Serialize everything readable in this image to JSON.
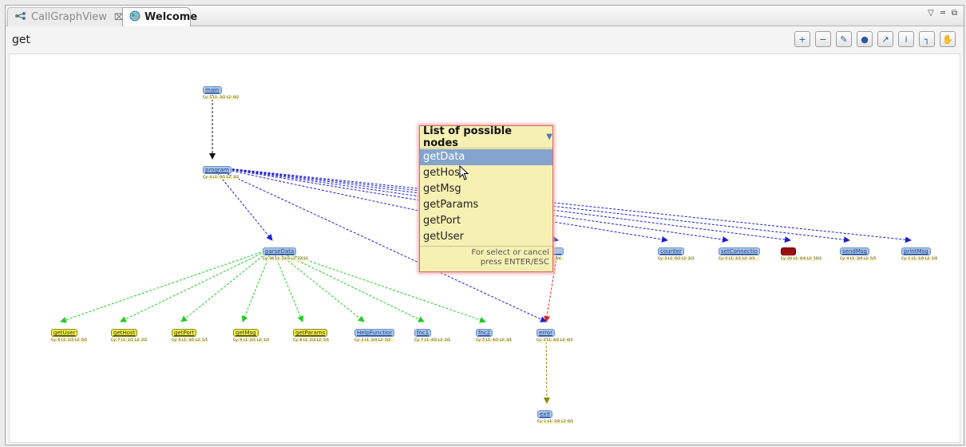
{
  "tabs": [
    {
      "label": "CallGraphView",
      "icon": "call-graph-icon",
      "close_glyph": "⌧"
    },
    {
      "label": "Welcome",
      "icon": "welcome-icon"
    }
  ],
  "view_controls": {
    "menu_glyph": "▽",
    "minimize_glyph": "═",
    "restore_glyph": "⧉"
  },
  "toolbar": {
    "search_value": "get",
    "buttons": [
      {
        "name": "zoom-in-button",
        "icon": "zoom-in-icon",
        "glyph": "+"
      },
      {
        "name": "zoom-out-button",
        "icon": "zoom-out-icon",
        "glyph": "−"
      },
      {
        "name": "highlight-button",
        "icon": "highlight-icon",
        "glyph": "✎"
      },
      {
        "name": "group-button",
        "icon": "group-icon",
        "glyph": "●"
      },
      {
        "name": "edge-button",
        "icon": "edge-icon",
        "glyph": "↗"
      },
      {
        "name": "info-button",
        "icon": "info-icon",
        "glyph": "i"
      },
      {
        "name": "tree-button",
        "icon": "tree-icon",
        "glyph": "┐"
      },
      {
        "name": "hand-button",
        "icon": "hand-icon",
        "glyph": "✋"
      }
    ]
  },
  "graph": {
    "nodes": [
      {
        "id": "main",
        "label": "main",
        "stats": "Cy: 5 L1: 3/2 L2: 0/2",
        "style": "blue"
      },
      {
        "id": "program",
        "label": "program",
        "stats": "Cy: 4 L1: 0/1 L2: 3/2",
        "style": "blue"
      },
      {
        "id": "parseData",
        "label": "parseData",
        "stats": "Cy: 36 L1: 22/3 L2: 22/12",
        "style": "blue"
      },
      {
        "id": "getData",
        "label": "",
        "stats": "L2: 4/4",
        "style": "blue"
      },
      {
        "id": "counter",
        "label": "counter",
        "stats": "Cy: 3 L1: 0/3 L2: 2/3",
        "style": "blue"
      },
      {
        "id": "setConnection",
        "label": "setConnectio",
        "stats": "Cy: 5 L1: 2/1 L2: 3/3",
        "style": "blue"
      },
      {
        "id": "red",
        "label": "",
        "stats": "Cy: 20 L1: 4/4 L2: 10/3",
        "style": "red"
      },
      {
        "id": "sendMsg",
        "label": "sendMsg",
        "stats": "Cy: 4 L1: 3/4 L2: 5/5",
        "style": "blue"
      },
      {
        "id": "printMsg",
        "label": "printMsg",
        "stats": "Cy: 1 L1: 1/0 L2: 1/0",
        "style": "blue"
      },
      {
        "id": "getUser",
        "label": "getUser",
        "stats": "Cy: 6 L1: 2/3 L2: 0/1",
        "style": "yellow"
      },
      {
        "id": "getHost",
        "label": "getHost",
        "stats": "Cy: 7 L1: 2/1 L2: 2/2",
        "style": "yellow"
      },
      {
        "id": "getPort",
        "label": "getPort",
        "stats": "Cy: 4 L1: 3/1 L2: 1/1",
        "style": "yellow"
      },
      {
        "id": "getMsg",
        "label": "getMsg",
        "stats": "Cy: 9 L1: 2/1 L2: 1/2",
        "style": "yellow"
      },
      {
        "id": "getParams",
        "label": "getParams",
        "stats": "Cy: 8 L1: 2/3 L2: 5/1",
        "style": "yellow"
      },
      {
        "id": "HelpFunction",
        "label": "HelpFunctior",
        "stats": "Cy: 3 L1: 2/4 L2: 5/2",
        "style": "blue"
      },
      {
        "id": "fnc1",
        "label": "fnc1",
        "stats": "Cy: 7 L1: 4/2 L2: 2/1",
        "style": "blue"
      },
      {
        "id": "fnc2",
        "label": "fnc2",
        "stats": "Cy: 5 L1: 4/2 L2: 3/1",
        "style": "blue"
      },
      {
        "id": "error",
        "label": "error",
        "stats": "Cy: 3 L1: 4/2 L2: 4/3",
        "style": "blue"
      },
      {
        "id": "exit",
        "label": "exit",
        "stats": "Cy: 1 L1: 1/0 L2: 0/1",
        "style": "blue"
      }
    ]
  },
  "popup": {
    "title": "List of possible nodes",
    "items": [
      "getData",
      "getHost",
      "getMsg",
      "getParams",
      "getPort",
      "getUser"
    ],
    "selected_index": 0,
    "footer_line1": "For select or cancel",
    "footer_line2": "press ENTER/ESC"
  },
  "colors": {
    "edge_blue": "#1f1fd6",
    "edge_green": "#22cc22",
    "edge_red": "#e02020",
    "edge_olive": "#8a8a10",
    "edge_black": "#111111"
  }
}
